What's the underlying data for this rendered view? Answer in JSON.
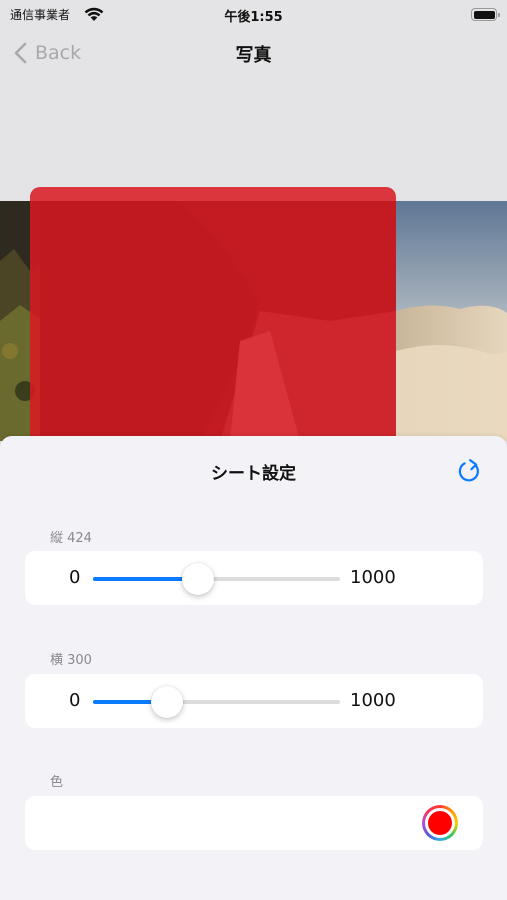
{
  "status_bar": {
    "carrier": "通信事業者",
    "time": "午後1:55"
  },
  "nav": {
    "back_label": "Back",
    "title": "写真"
  },
  "sheet": {
    "title": "シート設定",
    "reset_icon": "arrow-clockwise-icon",
    "height": {
      "label": "縦 424",
      "min": "0",
      "max": "1000",
      "value": 424,
      "range": [
        0,
        1000
      ]
    },
    "width": {
      "label": "横 300",
      "min": "0",
      "max": "1000",
      "value": 300,
      "range": [
        0,
        1000
      ]
    },
    "color": {
      "label": "色",
      "value": "#ff0000"
    }
  },
  "colors": {
    "accent": "#0a7aff",
    "overlay": "#da1822",
    "sheet_background": "#f2f2f7"
  }
}
